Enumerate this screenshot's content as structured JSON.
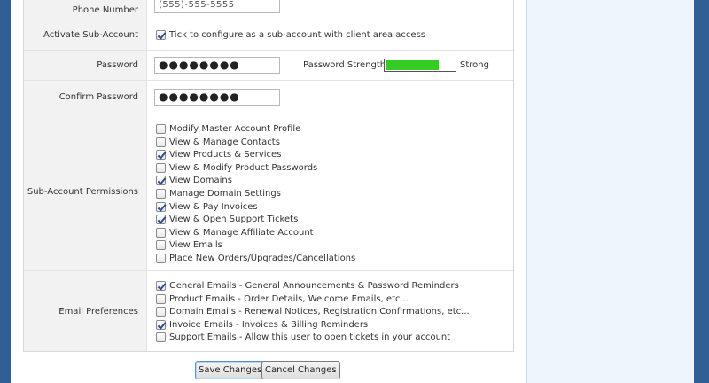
{
  "fields": {
    "phone": {
      "label": "Phone Number",
      "value": "(555)-555-5555"
    },
    "activate": {
      "label": "Activate Sub-Account",
      "checkbox_text": "Tick to configure as a sub-account with client area access",
      "checked": true
    },
    "password": {
      "label": "Password",
      "value": "●●●●●●●●",
      "strength_label": "Password Strength:",
      "strength_text": "Strong",
      "strength_fraction": 0.75,
      "strength_color": "#33cc22"
    },
    "confirm": {
      "label": "Confirm Password",
      "value": "●●●●●●●●"
    }
  },
  "permissions": {
    "label": "Sub-Account Permissions",
    "items": [
      {
        "text": "Modify Master Account Profile",
        "checked": false
      },
      {
        "text": "View & Manage Contacts",
        "checked": false
      },
      {
        "text": "View Products & Services",
        "checked": true
      },
      {
        "text": "View & Modify Product Passwords",
        "checked": false
      },
      {
        "text": "View Domains",
        "checked": true
      },
      {
        "text": "Manage Domain Settings",
        "checked": false
      },
      {
        "text": "View & Pay Invoices",
        "checked": true
      },
      {
        "text": "View & Open Support Tickets",
        "checked": true
      },
      {
        "text": "View & Manage Affiliate Account",
        "checked": false
      },
      {
        "text": "View Emails",
        "checked": false
      },
      {
        "text": "Place New Orders/Upgrades/Cancellations",
        "checked": false
      }
    ]
  },
  "email_prefs": {
    "label": "Email Preferences",
    "items": [
      {
        "text": "General Emails - General Announcements & Password Reminders",
        "checked": true
      },
      {
        "text": "Product Emails - Order Details, Welcome Emails, etc...",
        "checked": false
      },
      {
        "text": "Domain Emails - Renewal Notices, Registration Confirmations, etc...",
        "checked": false
      },
      {
        "text": "Invoice Emails - Invoices & Billing Reminders",
        "checked": true
      },
      {
        "text": "Support Emails - Allow this user to open tickets in your account",
        "checked": false
      }
    ]
  },
  "buttons": {
    "save": "Save Changes",
    "cancel": "Cancel Changes"
  },
  "colors": {
    "background": "#2f5f95",
    "side_panel": "#eef5fc"
  }
}
